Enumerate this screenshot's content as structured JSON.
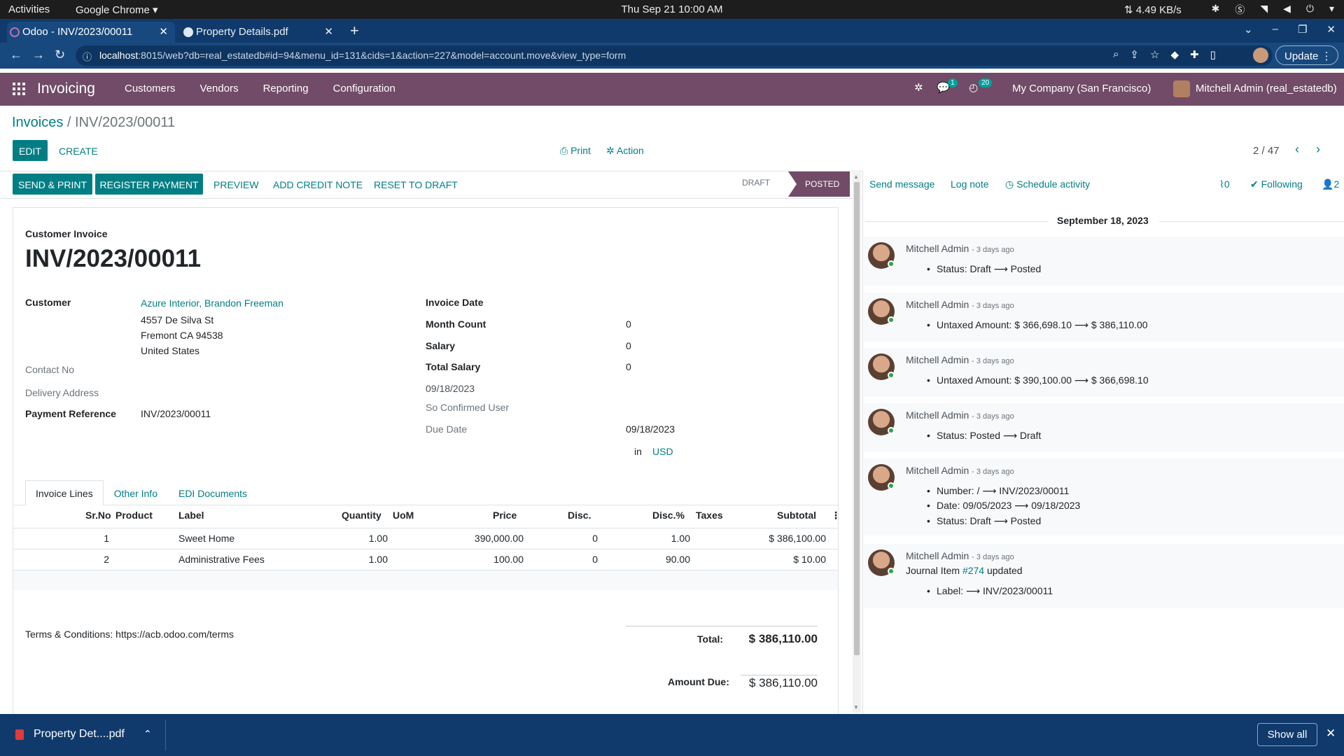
{
  "os": {
    "activities": "Activities",
    "app": "Google Chrome ▾",
    "clock": "Thu Sep 21  10:00 AM",
    "netspeed": "⇅ 4.49 KB/s"
  },
  "browser": {
    "tabs": [
      {
        "title": "Odoo - INV/2023/00011"
      },
      {
        "title": "Property Details.pdf"
      }
    ],
    "url_host": "localhost",
    "url_rest": ":8015/web?db=real_estatedb#id=94&menu_id=131&cids=1&action=227&model=account.move&view_type=form",
    "update_label": "Update"
  },
  "navbar": {
    "brand": "Invoicing",
    "menu": [
      "Customers",
      "Vendors",
      "Reporting",
      "Configuration"
    ],
    "messages_badge": "1",
    "activities_badge": "20",
    "company": "My Company (San Francisco)",
    "user": "Mitchell Admin (real_estatedb)"
  },
  "control_panel": {
    "breadcrumb_parent": "Invoices",
    "breadcrumb_sep": " / ",
    "breadcrumb_current": "INV/2023/00011",
    "edit": "EDIT",
    "create": "CREATE",
    "print": "Print",
    "action": "Action",
    "pager": "2 / 47"
  },
  "status_actions": {
    "send_print": "SEND & PRINT",
    "register_payment": "REGISTER PAYMENT",
    "preview": "PREVIEW",
    "add_credit_note": "ADD CREDIT NOTE",
    "reset_to_draft": "RESET TO DRAFT",
    "stage_draft": "DRAFT",
    "stage_posted": "POSTED"
  },
  "invoice": {
    "type_label": "Customer Invoice",
    "number": "INV/2023/00011",
    "customer_label": "Customer",
    "customer_name": "Azure Interior, Brandon Freeman",
    "address": [
      "4557 De Silva St",
      "Fremont CA 94538",
      "United States"
    ],
    "contact_no_label": "Contact No",
    "delivery_address_label": "Delivery Address",
    "payment_reference_label": "Payment Reference",
    "payment_reference": "INV/2023/00011",
    "invoice_date_label": "Invoice Date",
    "month_count_label": "Month Count",
    "month_count": "0",
    "salary_label": "Salary",
    "salary": "0",
    "total_salary_label": "Total Salary",
    "total_salary": "0",
    "invoice_date_value": "09/18/2023",
    "so_confirmed_user_label": "So Confirmed User",
    "due_date_label": "Due Date",
    "due_date": "09/18/2023",
    "in_label": "in",
    "currency": "USD"
  },
  "notebook": {
    "tabs": [
      "Invoice Lines",
      "Other Info",
      "EDI Documents"
    ]
  },
  "lines": {
    "headers": {
      "srno": "Sr.No",
      "product": "Product",
      "label": "Label",
      "quantity": "Quantity",
      "uom": "UoM",
      "price": "Price",
      "disc": "Disc.",
      "disc_pct": "Disc.%",
      "taxes": "Taxes",
      "subtotal": "Subtotal"
    },
    "rows": [
      {
        "srno": "1",
        "label": "Sweet Home",
        "quantity": "1.00",
        "price": "390,000.00",
        "disc": "0",
        "disc_pct": "1.00",
        "subtotal": "$ 386,100.00"
      },
      {
        "srno": "2",
        "label": "Administrative Fees",
        "quantity": "1.00",
        "price": "100.00",
        "disc": "0",
        "disc_pct": "90.00",
        "subtotal": "$ 10.00"
      }
    ]
  },
  "footer": {
    "terms": "Terms & Conditions: https://acb.odoo.com/terms",
    "total_label": "Total:",
    "total": "$ 386,110.00",
    "amount_due_label": "Amount Due:",
    "amount_due": "$ 386,110.00"
  },
  "chatter": {
    "send_message": "Send message",
    "log_note": "Log note",
    "schedule_activity": "Schedule activity",
    "attachments": "0",
    "following": "Following",
    "followers": "2",
    "date_separator": "September 18, 2023",
    "messages": [
      {
        "author": "Mitchell Admin",
        "ago": "- 3 days ago",
        "lines": [
          "Status: Draft ⟶ Posted"
        ]
      },
      {
        "author": "Mitchell Admin",
        "ago": "- 3 days ago",
        "lines": [
          "Untaxed Amount: $ 366,698.10 ⟶ $ 386,110.00"
        ]
      },
      {
        "author": "Mitchell Admin",
        "ago": "- 3 days ago",
        "lines": [
          "Untaxed Amount: $ 390,100.00 ⟶ $ 366,698.10"
        ]
      },
      {
        "author": "Mitchell Admin",
        "ago": "- 3 days ago",
        "lines": [
          "Status: Posted ⟶ Draft"
        ]
      },
      {
        "author": "Mitchell Admin",
        "ago": "- 3 days ago",
        "lines": [
          "Number: / ⟶ INV/2023/00011",
          "Date: 09/05/2023 ⟶ 09/18/2023",
          "Status: Draft ⟶ Posted"
        ]
      },
      {
        "author": "Mitchell Admin",
        "ago": "- 3 days ago",
        "journal_prefix": "Journal Item ",
        "journal_link": "#274",
        "journal_suffix": " updated",
        "lines": [
          "Label: ⟶ INV/2023/00011"
        ]
      }
    ]
  },
  "downloads": {
    "file": "Property Det....pdf",
    "show_all": "Show all"
  },
  "colors": {
    "brand": "#714b67",
    "accent": "#017e84",
    "chrome": "#17497f"
  }
}
